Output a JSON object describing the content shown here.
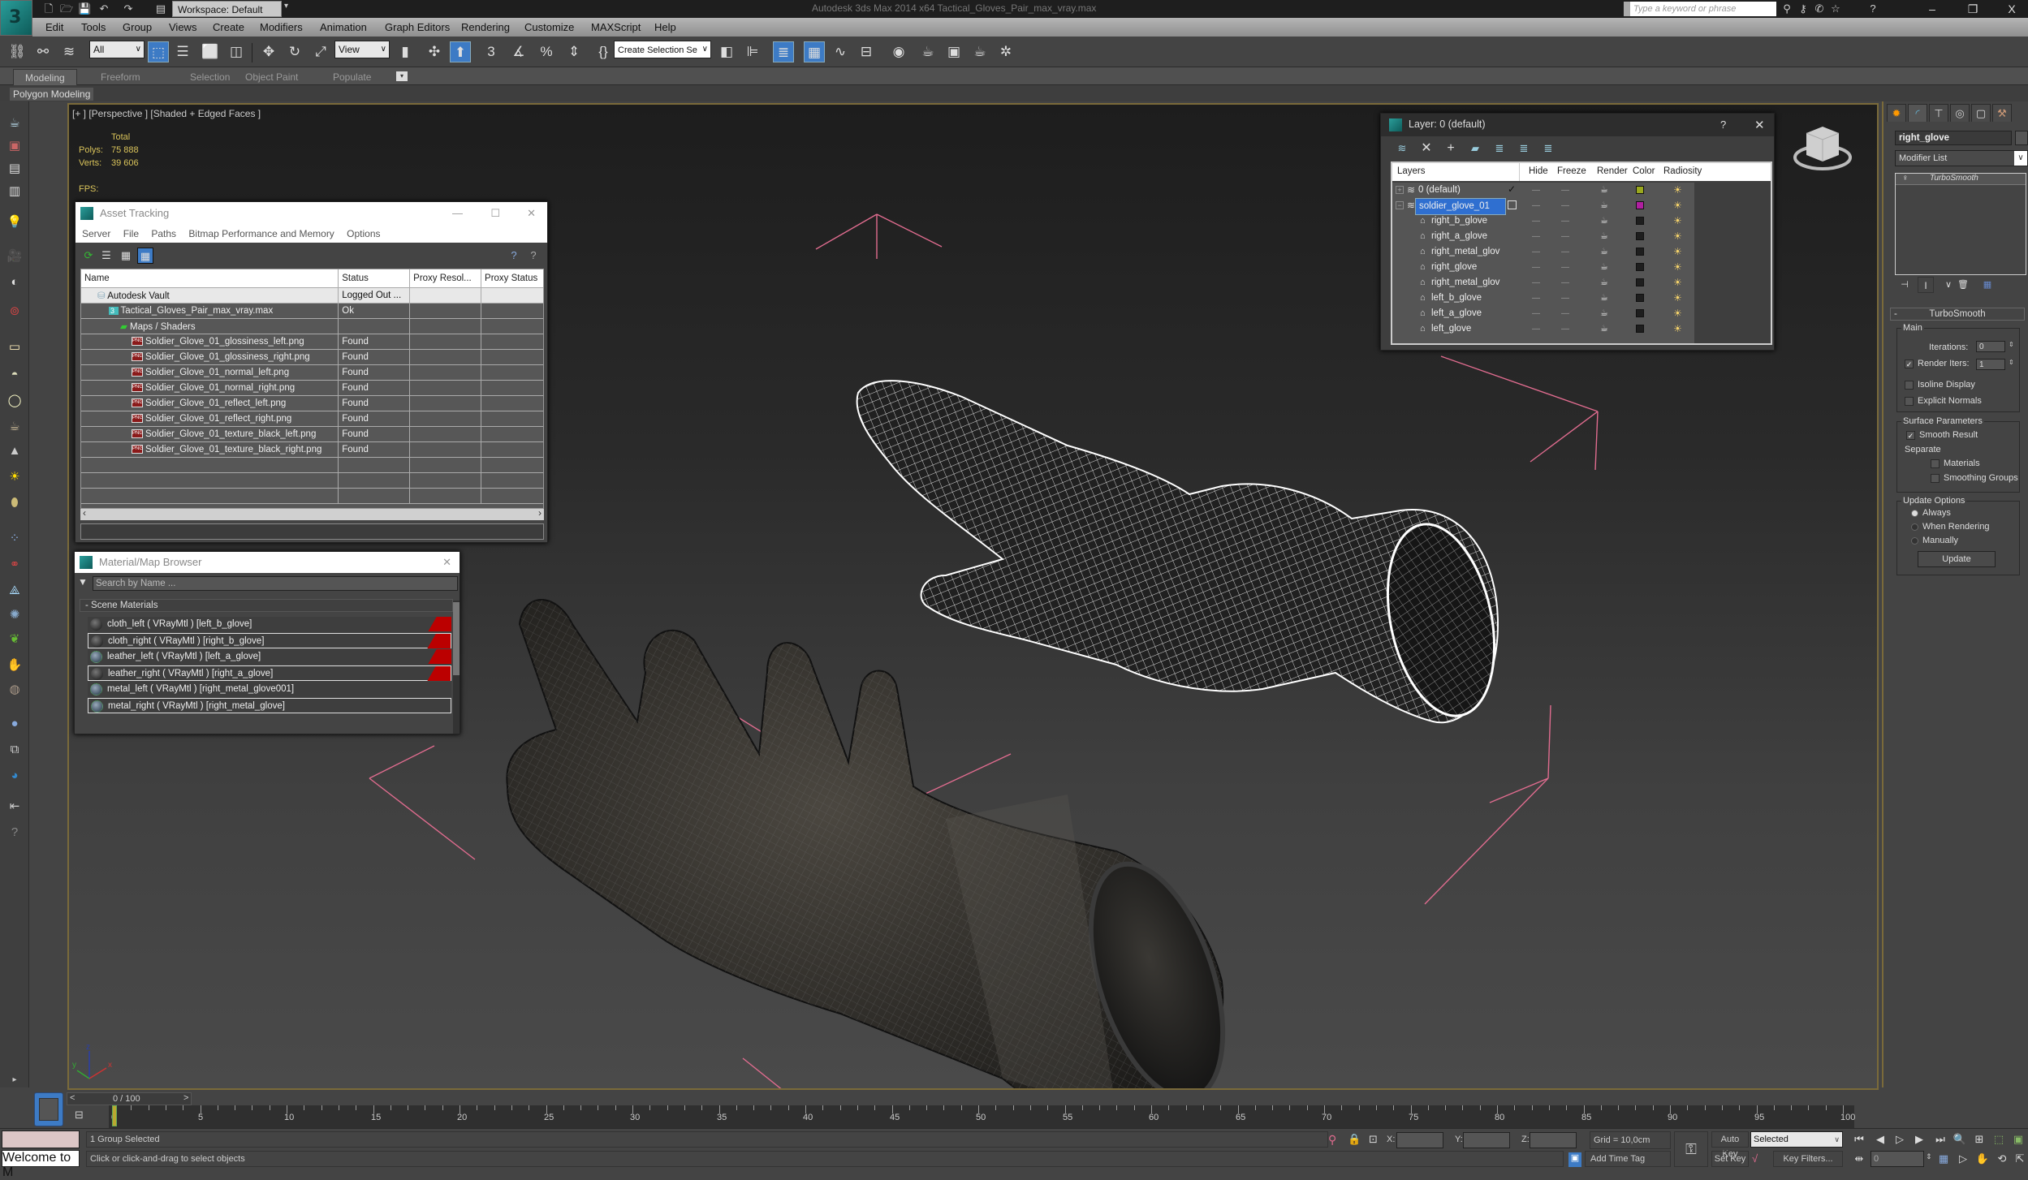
{
  "title_bar": {
    "workspace": "Workspace: Default",
    "app_title": "Autodesk 3ds Max  2014 x64     Tactical_Gloves_Pair_max_vray.max",
    "help_search_placeholder": "Type a keyword or phrase",
    "window_controls": {
      "minimize": "–",
      "restore": "❐",
      "close": "X"
    }
  },
  "menu": [
    "Edit",
    "Tools",
    "Group",
    "Views",
    "Create",
    "Modifiers",
    "Animation",
    "Graph Editors",
    "Rendering",
    "Customize",
    "MAXScript",
    "Help"
  ],
  "toolbar": {
    "selection_filter": "All",
    "reference_coord": "View",
    "named_selection_placeholder": "Create Selection Se"
  },
  "ribbon": {
    "tabs": [
      "Modeling",
      "Freeform",
      "Selection",
      "Object Paint",
      "Populate"
    ],
    "active_tab": "Modeling",
    "panel_label": "Polygon Modeling"
  },
  "viewport": {
    "label": "[+ ] [Perspective ] [Shaded + Edged Faces ]",
    "stats": {
      "header": "Total",
      "polys_label": "Polys:",
      "polys_value": "75 888",
      "verts_label": "Verts:",
      "verts_value": "39 606",
      "fps_label": "FPS:"
    },
    "axis": {
      "x": "x",
      "y": "y",
      "z": "z"
    },
    "selection_color": "#e06c8f",
    "border_color": "#7a6a3a"
  },
  "asset_tracking": {
    "title": "Asset Tracking",
    "menu": [
      "Server",
      "File",
      "Paths",
      "Bitmap Performance and Memory",
      "Options"
    ],
    "columns": [
      "Name",
      "Status",
      "Proxy Resol...",
      "Proxy Status"
    ],
    "rows": [
      {
        "name": "Autodesk Vault",
        "status": "Logged Out ...",
        "type": "vault"
      },
      {
        "name": "Tactical_Gloves_Pair_max_vray.max",
        "status": "Ok",
        "type": "max"
      },
      {
        "name": "Maps / Shaders",
        "status": "",
        "type": "maps"
      },
      {
        "name": "Soldier_Glove_01_glossiness_left.png",
        "status": "Found",
        "type": "png"
      },
      {
        "name": "Soldier_Glove_01_glossiness_right.png",
        "status": "Found",
        "type": "png"
      },
      {
        "name": "Soldier_Glove_01_normal_left.png",
        "status": "Found",
        "type": "png"
      },
      {
        "name": "Soldier_Glove_01_normal_right.png",
        "status": "Found",
        "type": "png"
      },
      {
        "name": "Soldier_Glove_01_reflect_left.png",
        "status": "Found",
        "type": "png"
      },
      {
        "name": "Soldier_Glove_01_reflect_right.png",
        "status": "Found",
        "type": "png"
      },
      {
        "name": "Soldier_Glove_01_texture_black_left.png",
        "status": "Found",
        "type": "png"
      },
      {
        "name": "Soldier_Glove_01_texture_black_right.png",
        "status": "Found",
        "type": "png"
      }
    ]
  },
  "material_browser": {
    "title": "Material/Map Browser",
    "search_placeholder": "Search by Name ...",
    "group_label": "- Scene Materials",
    "items": [
      {
        "label": "cloth_left  ( VRayMtl ) [left_b_glove]",
        "selected": false,
        "flag": true,
        "tex": false
      },
      {
        "label": "cloth_right  ( VRayMtl ) [right_b_glove]",
        "selected": true,
        "flag": true,
        "tex": false
      },
      {
        "label": "leather_left  ( VRayMtl ) [left_a_glove]",
        "selected": false,
        "flag": true,
        "tex": true
      },
      {
        "label": "leather_right  ( VRayMtl ) [right_a_glove]",
        "selected": true,
        "flag": true,
        "tex": false
      },
      {
        "label": "metal_left  ( VRayMtl ) [right_metal_glove001]",
        "selected": false,
        "flag": false,
        "tex": true
      },
      {
        "label": "metal_right  ( VRayMtl ) [right_metal_glove]",
        "selected": true,
        "flag": false,
        "tex": true
      }
    ]
  },
  "layer_manager": {
    "title": "Layer: 0 (default)",
    "help": "?",
    "columns": [
      "Layers",
      "Hide",
      "Freeze",
      "Render",
      "Color",
      "Radiosity"
    ],
    "layers": [
      {
        "name": "0 (default)",
        "level": 0,
        "color": "#9aa81e",
        "current": true,
        "selected": false
      },
      {
        "name": "soldier_glove_01",
        "level": 0,
        "color": "#b01fa0",
        "current": false,
        "selected": true
      },
      {
        "name": "right_b_glove",
        "level": 1,
        "color": "#1e1e1e"
      },
      {
        "name": "right_a_glove",
        "level": 1,
        "color": "#1e1e1e"
      },
      {
        "name": "right_metal_glov",
        "level": 1,
        "color": "#1e1e1e"
      },
      {
        "name": "right_glove",
        "level": 1,
        "color": "#1e1e1e"
      },
      {
        "name": "right_metal_glov",
        "level": 1,
        "color": "#1e1e1e"
      },
      {
        "name": "left_b_glove",
        "level": 1,
        "color": "#1e1e1e"
      },
      {
        "name": "left_a_glove",
        "level": 1,
        "color": "#1e1e1e"
      },
      {
        "name": "left_glove",
        "level": 1,
        "color": "#1e1e1e"
      }
    ]
  },
  "command_panel": {
    "object_name": "right_glove",
    "modifier_list": "Modifier List",
    "stack": [
      "TurboSmooth"
    ],
    "rollout_title": "TurboSmooth",
    "main_group": "Main",
    "iterations_label": "Iterations:",
    "iterations_value": "0",
    "render_iters_label": "Render Iters:",
    "render_iters_value": "1",
    "render_iters_checked": true,
    "isoline_label": "Isoline Display",
    "isoline_checked": false,
    "explicit_normals_label": "Explicit Normals",
    "explicit_normals_checked": false,
    "surface_group": "Surface Parameters",
    "smooth_result_label": "Smooth Result",
    "smooth_result_checked": true,
    "separate_label": "Separate",
    "materials_label": "Materials",
    "smoothing_groups_label": "Smoothing Groups",
    "update_group": "Update Options",
    "update_options": [
      "Always",
      "When Rendering",
      "Manually"
    ],
    "update_selected": "Always",
    "update_button": "Update"
  },
  "timeline": {
    "frame_display": "0 / 100",
    "prev": "<",
    "next": ">",
    "current_frame": 0,
    "ticks": [
      "0",
      "5",
      "10",
      "15",
      "20",
      "25",
      "30",
      "35",
      "40",
      "45",
      "50",
      "55",
      "60",
      "65",
      "70",
      "75",
      "80",
      "85",
      "90",
      "95",
      "100"
    ]
  },
  "status": {
    "maxscript_listener": "Welcome to M",
    "selection_status": "1 Group Selected",
    "prompt": "Click or click-and-drag to select objects",
    "x_label": "X:",
    "y_label": "Y:",
    "z_label": "Z:",
    "grid": "Grid = 10,0cm",
    "add_time_tag": "Add Time Tag",
    "auto_key": "Auto Key",
    "set_key": "Set Key",
    "key_mode": "Selected",
    "key_filters": "Key Filters...",
    "frame_field": "0"
  }
}
